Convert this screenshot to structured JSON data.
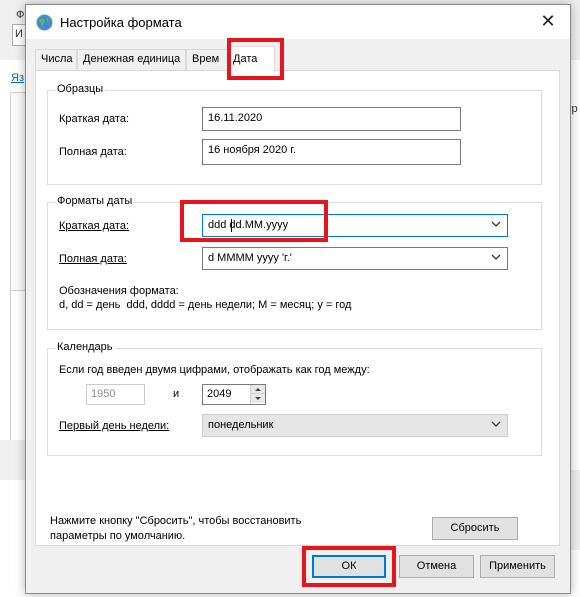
{
  "background": {
    "fragments": [
      "И",
      "Ф",
      "Яз",
      "мотр"
    ]
  },
  "dialog": {
    "title": "Настройка формата",
    "close_glyph": "✕",
    "tabs": [
      {
        "label": "Числа"
      },
      {
        "label": "Денежная единица"
      },
      {
        "label": "Врем"
      },
      {
        "label": "Дата"
      }
    ],
    "samples": {
      "title": "Образцы",
      "short_label": "Краткая дата:",
      "short_value": "16.11.2020",
      "long_label": "Полная дата:",
      "long_value": "16 ноября 2020 г."
    },
    "date_formats": {
      "title": "Форматы даты",
      "short_label": "Краткая дата:",
      "short_value": "ddd dd.MM.yyyy",
      "long_label": "Полная дата:",
      "long_value": "d MMMM yyyy 'г.'",
      "notation_title": "Обозначения формата:",
      "notation_text": "d, dd = день  ddd, dddd = день недели; M = месяц; y = год"
    },
    "calendar": {
      "title": "Календарь",
      "two_digit_label": "Если год введен двумя цифрами, отображать как год между:",
      "year_from": "1950",
      "and_label": "и",
      "year_to": "2049",
      "first_day_label": "Первый день недели:",
      "first_day_value": "понедельник"
    },
    "reset_hint_line1": "Нажмите кнопку \"Сбросить\", чтобы восстановить",
    "reset_hint_line2": "параметры по умолчанию.",
    "reset_label": "Сбросить",
    "ok_label": "ОК",
    "cancel_label": "Отмена",
    "apply_label": "Применить"
  },
  "colors": {
    "highlight": "#e8141c",
    "focus": "#0078d7"
  }
}
